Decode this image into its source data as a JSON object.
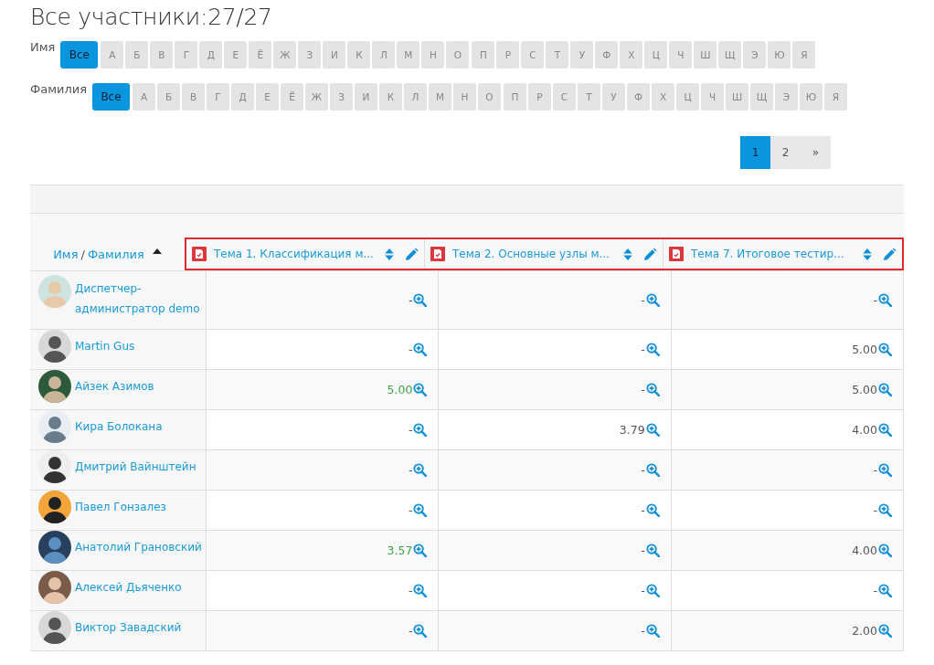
{
  "title": "Все участники:27/27",
  "filters": [
    {
      "label": "Имя",
      "groups": [
        [
          {
            "text": "Все",
            "selected": true
          }
        ],
        [
          {
            "text": "А",
            "selected": false
          },
          {
            "text": "Б",
            "selected": false
          },
          {
            "text": "В",
            "selected": false
          },
          {
            "text": "Г",
            "selected": false
          },
          {
            "text": "Д",
            "selected": false
          },
          {
            "text": "Е",
            "selected": false
          },
          {
            "text": "Ё",
            "selected": false
          },
          {
            "text": "Ж",
            "selected": false
          },
          {
            "text": "З",
            "selected": false
          },
          {
            "text": "И",
            "selected": false
          },
          {
            "text": "К",
            "selected": false
          },
          {
            "text": "Л",
            "selected": false
          },
          {
            "text": "М",
            "selected": false
          },
          {
            "text": "Н",
            "selected": false
          },
          {
            "text": "О",
            "selected": false
          }
        ],
        [
          {
            "text": "П",
            "selected": false
          },
          {
            "text": "Р",
            "selected": false
          },
          {
            "text": "С",
            "selected": false
          },
          {
            "text": "Т",
            "selected": false
          },
          {
            "text": "У",
            "selected": false
          },
          {
            "text": "Ф",
            "selected": false
          },
          {
            "text": "Х",
            "selected": false
          },
          {
            "text": "Ц",
            "selected": false
          },
          {
            "text": "Ч",
            "selected": false
          },
          {
            "text": "Ш",
            "selected": false
          },
          {
            "text": "Щ",
            "selected": false
          },
          {
            "text": "Э",
            "selected": false
          },
          {
            "text": "Ю",
            "selected": false
          },
          {
            "text": "Я",
            "selected": false
          }
        ]
      ]
    },
    {
      "label": "Фамилия",
      "groups": [
        [
          {
            "text": "Все",
            "selected": true
          }
        ],
        [
          {
            "text": "А",
            "selected": false
          },
          {
            "text": "Б",
            "selected": false
          },
          {
            "text": "В",
            "selected": false
          },
          {
            "text": "Г",
            "selected": false
          },
          {
            "text": "Д",
            "selected": false
          },
          {
            "text": "Е",
            "selected": false
          },
          {
            "text": "Ё",
            "selected": false
          },
          {
            "text": "Ж",
            "selected": false
          },
          {
            "text": "З",
            "selected": false
          },
          {
            "text": "И",
            "selected": false
          },
          {
            "text": "К",
            "selected": false
          },
          {
            "text": "Л",
            "selected": false
          },
          {
            "text": "М",
            "selected": false
          },
          {
            "text": "Н",
            "selected": false
          },
          {
            "text": "О",
            "selected": false
          }
        ],
        [
          {
            "text": "П",
            "selected": false
          },
          {
            "text": "Р",
            "selected": false
          },
          {
            "text": "С",
            "selected": false
          },
          {
            "text": "Т",
            "selected": false
          },
          {
            "text": "У",
            "selected": false
          },
          {
            "text": "Ф",
            "selected": false
          },
          {
            "text": "Х",
            "selected": false
          },
          {
            "text": "Ц",
            "selected": false
          },
          {
            "text": "Ч",
            "selected": false
          },
          {
            "text": "Ш",
            "selected": false
          },
          {
            "text": "Щ",
            "selected": false
          },
          {
            "text": "Э",
            "selected": false
          },
          {
            "text": "Ю",
            "selected": false
          },
          {
            "text": "Я",
            "selected": false
          }
        ]
      ]
    }
  ],
  "pagination": [
    {
      "text": "1",
      "selected": true
    },
    {
      "text": "2",
      "selected": false
    },
    {
      "text": "»",
      "selected": false
    }
  ],
  "table": {
    "name_header": {
      "first": "Имя",
      "separator": "/",
      "last": "Фамилия"
    },
    "columns": [
      {
        "title": "Тема 1. Классификация м..."
      },
      {
        "title": "Тема 2. Основные узлы м..."
      },
      {
        "title": "Тема 7. Итоговое тестир..."
      }
    ],
    "rows": [
      {
        "name": "Диспетчер-администратор demo",
        "grades": [
          {
            "value": "-",
            "passed": false
          },
          {
            "value": "-",
            "passed": false
          },
          {
            "value": "-",
            "passed": false
          }
        ]
      },
      {
        "name": "Martin Gus",
        "grades": [
          {
            "value": "-",
            "passed": false
          },
          {
            "value": "-",
            "passed": false
          },
          {
            "value": "5.00",
            "passed": false
          }
        ]
      },
      {
        "name": "Айзек Азимов",
        "grades": [
          {
            "value": "5.00",
            "passed": true
          },
          {
            "value": "-",
            "passed": false
          },
          {
            "value": "5.00",
            "passed": false
          }
        ]
      },
      {
        "name": "Кира Болокана",
        "grades": [
          {
            "value": "-",
            "passed": false
          },
          {
            "value": "3.79",
            "passed": false
          },
          {
            "value": "4.00",
            "passed": false
          }
        ]
      },
      {
        "name": "Дмитрий Вайнштейн",
        "grades": [
          {
            "value": "-",
            "passed": false
          },
          {
            "value": "-",
            "passed": false
          },
          {
            "value": "-",
            "passed": false
          }
        ]
      },
      {
        "name": "Павел Гонзалез",
        "grades": [
          {
            "value": "-",
            "passed": false
          },
          {
            "value": "-",
            "passed": false
          },
          {
            "value": "-",
            "passed": false
          }
        ]
      },
      {
        "name": "Анатолий Грановский",
        "grades": [
          {
            "value": "3.57",
            "passed": true
          },
          {
            "value": "-",
            "passed": false
          },
          {
            "value": "4.00",
            "passed": false
          }
        ]
      },
      {
        "name": "Алексей Дьяченко",
        "grades": [
          {
            "value": "-",
            "passed": false
          },
          {
            "value": "-",
            "passed": false
          },
          {
            "value": "-",
            "passed": false
          }
        ]
      },
      {
        "name": "Виктор Завадский",
        "grades": [
          {
            "value": "-",
            "passed": false
          },
          {
            "value": "-",
            "passed": false
          },
          {
            "value": "2.00",
            "passed": false
          }
        ]
      }
    ]
  }
}
